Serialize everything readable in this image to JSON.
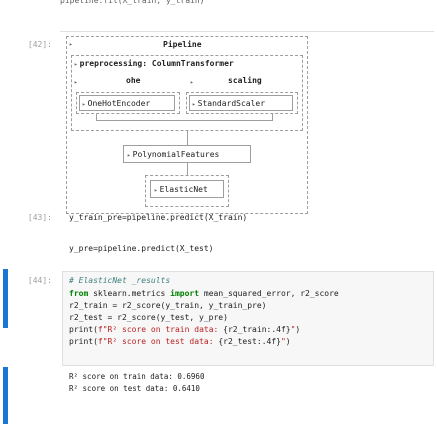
{
  "top_fragment": "pipeline.fit(X_train, y_train)",
  "cells": [
    {
      "prompt": "[42]:",
      "pipeline": {
        "title": "Pipeline",
        "preprocessing_label": "preprocessing: ColumnTransformer",
        "ohe_label": "ohe",
        "scaling_label": "scaling",
        "onehot_label": "OneHotEncoder",
        "standard_label": "StandardScaler",
        "poly_label": "PolynomialFeatures",
        "elastic_label": "ElasticNet"
      }
    },
    {
      "prompt": "[43]:",
      "lines": [
        "y_train_pre=pipeline.predict(X_train)",
        "y_pre=pipeline.predict(X_test)"
      ]
    },
    {
      "prompt": "[44]:",
      "comment": "# ElasticNet _results",
      "import_line": {
        "kw_from": "from",
        "module": " sklearn.metrics ",
        "kw_import": "import",
        "names": " mean_squared_error, r2_score"
      },
      "line_r2_train": "r2_train = r2_score(y_train, y_train_pre)",
      "line_r2_test": "r2_test = r2_score(y_test, y_pre)",
      "print1": {
        "fn": "print",
        "open": "(",
        "str": "f\"R² score on train data: ",
        "expr": "{r2_train:.4f}",
        "close_str": "\"",
        "close": ")"
      },
      "print2": {
        "fn": "print",
        "open": "(",
        "str": "f\"R² score on test data: ",
        "expr": "{r2_test:.4f}",
        "close_str": "\"",
        "close": ")"
      },
      "output": [
        "R² score on train data: 0.6960",
        "R² score on test data: 0.6410"
      ]
    }
  ],
  "colors": {
    "active_cell_bar": "#1976d2",
    "keyword": "#008000",
    "comment": "#408080",
    "string": "#ba2121"
  }
}
